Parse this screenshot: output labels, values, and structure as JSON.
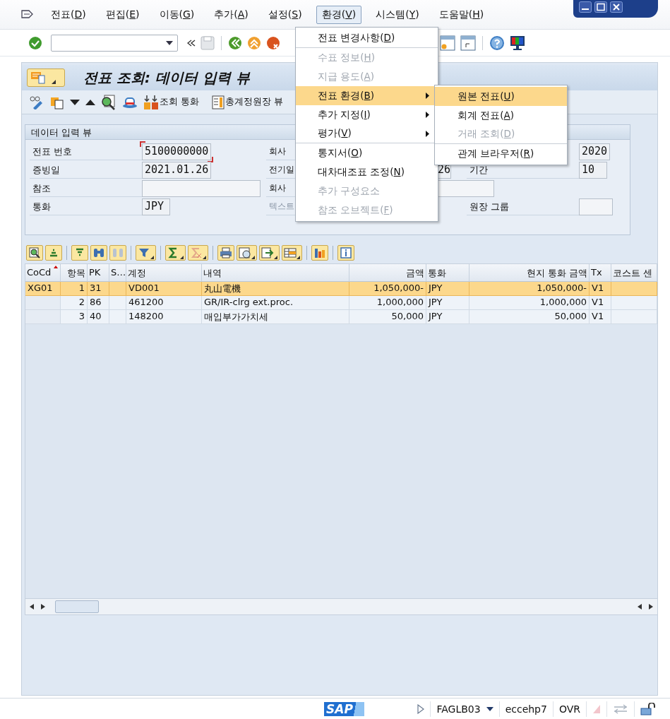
{
  "menu_bar": [
    {
      "label": "전표(D)",
      "selected": false
    },
    {
      "label": "편집(E)",
      "selected": false
    },
    {
      "label": "이동(G)",
      "selected": false
    },
    {
      "label": "추가(A)",
      "selected": false
    },
    {
      "label": "설정(S)",
      "selected": false
    },
    {
      "label": "환경(V)",
      "selected": true
    },
    {
      "label": "시스템(Y)",
      "selected": false
    },
    {
      "label": "도움말(H)",
      "selected": false
    }
  ],
  "open_menu": {
    "items": [
      {
        "label": "전표 변경사항(D)",
        "disabled": false,
        "selected": false,
        "submenu": false,
        "divider_after": true
      },
      {
        "label": "수표 정보(H)",
        "disabled": true,
        "selected": false,
        "submenu": false,
        "divider_after": false
      },
      {
        "label": "지급 용도(A)",
        "disabled": true,
        "selected": false,
        "submenu": false,
        "divider_after": false
      },
      {
        "label": "전표 환경(B)",
        "disabled": false,
        "selected": true,
        "submenu": true,
        "divider_after": false
      },
      {
        "label": "추가 지정(I)",
        "disabled": false,
        "selected": false,
        "submenu": true,
        "divider_after": false
      },
      {
        "label": "평가(V)",
        "disabled": false,
        "selected": false,
        "submenu": true,
        "divider_after": true
      },
      {
        "label": "통지서(O)",
        "disabled": false,
        "selected": false,
        "submenu": false,
        "divider_after": false
      },
      {
        "label": "대차대조표 조정(N)",
        "disabled": false,
        "selected": false,
        "submenu": false,
        "divider_after": false
      },
      {
        "label": "추가 구성요소",
        "disabled": true,
        "selected": false,
        "submenu": false,
        "divider_after": false
      },
      {
        "label": "참조 오브젝트(F)",
        "disabled": true,
        "selected": false,
        "submenu": false,
        "divider_after": false
      }
    ],
    "submenu": [
      {
        "label": "원본 전표(U)",
        "disabled": false,
        "selected": true,
        "divider_after": false
      },
      {
        "label": "회계 전표(A)",
        "disabled": false,
        "selected": false,
        "divider_after": false
      },
      {
        "label": "거래 조회(D)",
        "disabled": true,
        "selected": false,
        "divider_after": true
      },
      {
        "label": "관계 브라우저(R)",
        "disabled": false,
        "selected": false,
        "divider_after": false
      }
    ]
  },
  "screen_title": "전표 조회: 데이터 입력 뷰",
  "app_toolbar": [
    {
      "label": "조회 통화"
    },
    {
      "label": "총계정원장 뷰"
    }
  ],
  "group": {
    "title": "데이터 입력 뷰",
    "rows": [
      {
        "label": "전표 번호",
        "value": "5100000000",
        "focused": true,
        "label_2": "회사",
        "value_3": "2020"
      },
      {
        "label": "증빙일",
        "value": "2021.01.26",
        "focused": false,
        "label_2": "전기일",
        "value_2": "26",
        "label_3": "기간",
        "value_3": "10"
      },
      {
        "label": "참조",
        "focused": false,
        "wide": true,
        "label_2": "회사",
        "field_2": true
      },
      {
        "label": "통화",
        "value": "JPY",
        "focused": false,
        "label_2": "텍스트",
        "label_2_disabled": true,
        "label_3": "원장 그룹",
        "field_3": true
      }
    ]
  },
  "table": {
    "columns": [
      {
        "label": "CoCd",
        "kind": "text",
        "sorted": true
      },
      {
        "label": "항목",
        "kind": "number",
        "sorted": false
      },
      {
        "label": "PK",
        "kind": "text",
        "sorted": false
      },
      {
        "label": "S…",
        "kind": "text",
        "sorted": false
      },
      {
        "label": "계정",
        "kind": "text",
        "sorted": false
      },
      {
        "label": "내역",
        "kind": "text",
        "sorted": false
      },
      {
        "label": "금액",
        "kind": "number",
        "sorted": false
      },
      {
        "label": "통화",
        "kind": "text",
        "sorted": false
      },
      {
        "label": "현지 통화 금액",
        "kind": "number",
        "sorted": false
      },
      {
        "label": "Tx",
        "kind": "text",
        "sorted": false
      },
      {
        "label": "코스트 센",
        "kind": "text",
        "sorted": false
      }
    ],
    "rows": [
      {
        "selected": true,
        "cells": [
          "XG01",
          "1",
          "31",
          null,
          "VD001",
          "丸山電機",
          "1,050,000-",
          "JPY",
          "1,050,000-",
          "V1",
          null
        ]
      },
      {
        "selected": false,
        "cells": [
          null,
          "2",
          "86",
          null,
          "461200",
          "GR/IR-clrg ext.proc.",
          "1,000,000",
          "JPY",
          "1,000,000",
          "V1",
          null
        ]
      },
      {
        "selected": false,
        "cells": [
          null,
          "3",
          "40",
          null,
          "148200",
          "매입부가가치세",
          "50,000",
          "JPY",
          "50,000",
          "V1",
          null
        ]
      }
    ]
  },
  "status_bar": {
    "logo": "SAP",
    "transaction": "FAGLB03",
    "system": "eccehp7",
    "mode": "OVR"
  }
}
